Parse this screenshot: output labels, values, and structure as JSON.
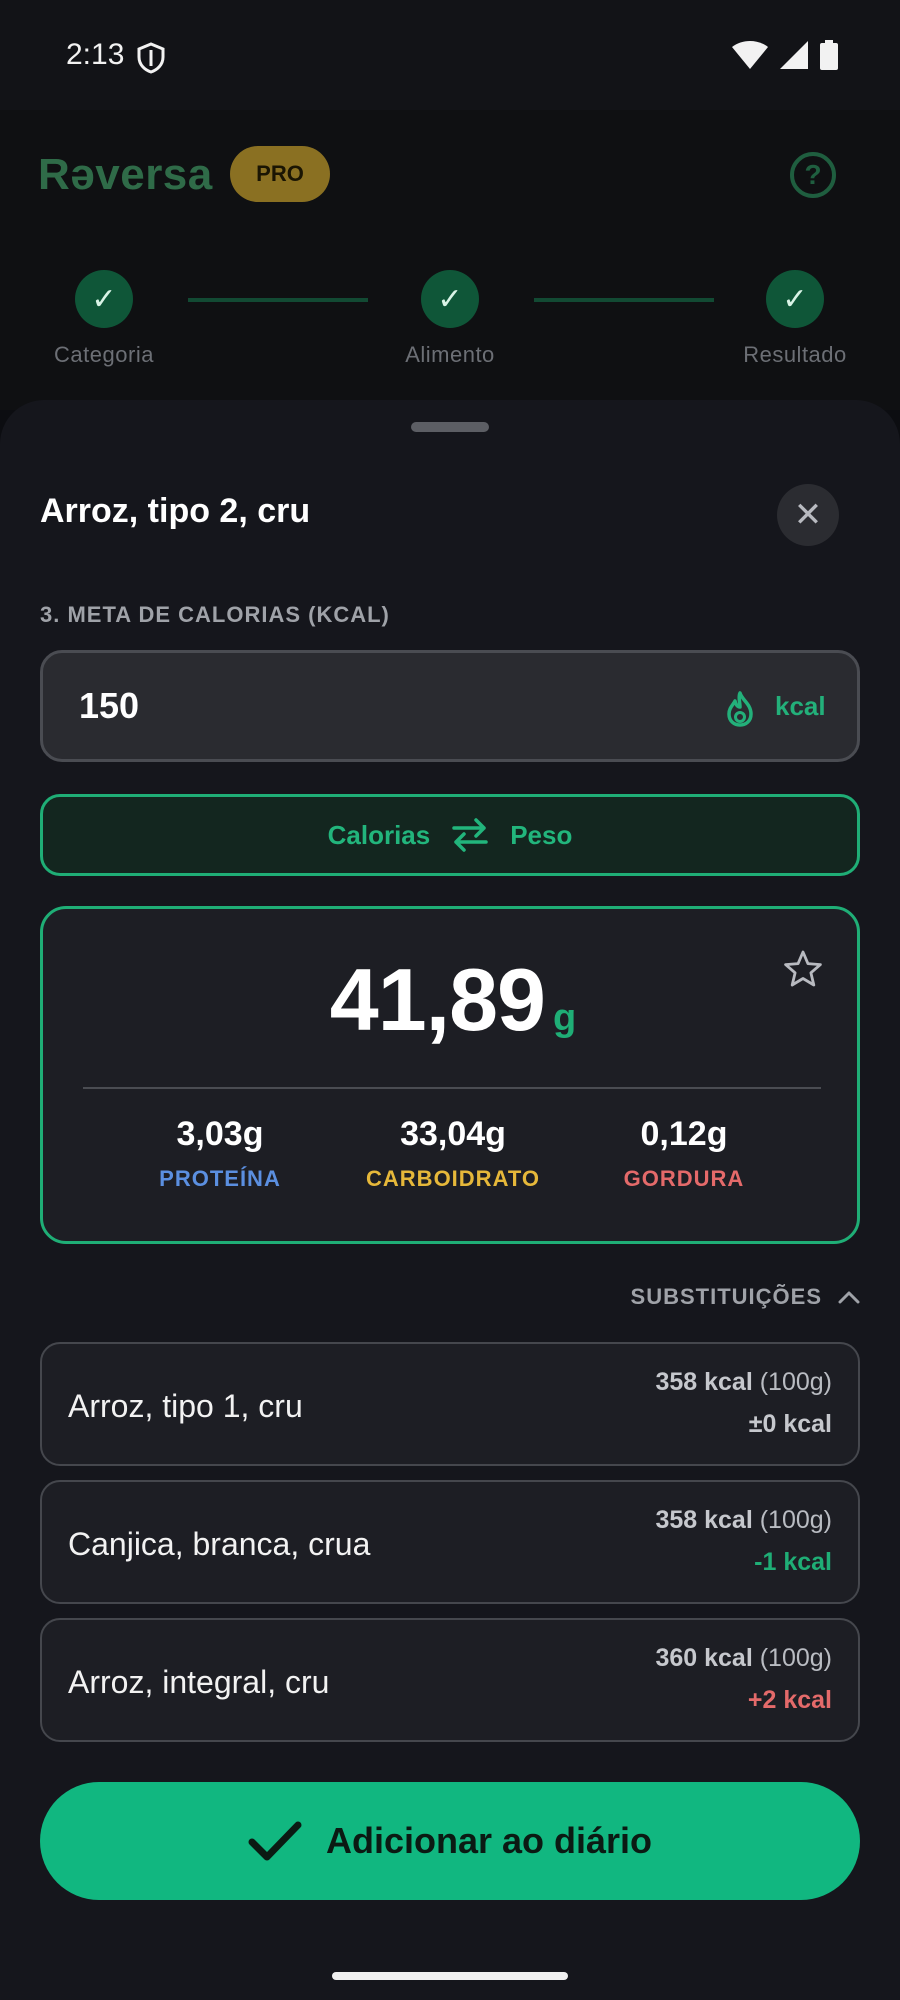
{
  "status_bar": {
    "time": "2:13"
  },
  "header": {
    "logo": "Rəversa",
    "badge": "PRO",
    "help": "?",
    "steps": [
      {
        "label": "Categoria",
        "check": "✓"
      },
      {
        "label": "Alimento",
        "check": "✓"
      },
      {
        "label": "Resultado",
        "check": "✓"
      }
    ]
  },
  "sheet": {
    "title": "Arroz, tipo 2, cru",
    "close": "✕",
    "section_label": "3. META DE CALORIAS (KCAL)",
    "input": {
      "value": "150",
      "unit": "kcal",
      "icon": "flame-icon"
    },
    "toggle": {
      "left": "Calorias",
      "right": "Peso",
      "icon": "swap-icon"
    },
    "result": {
      "value": "41,89",
      "unit": "g",
      "macros": [
        {
          "value": "3,03g",
          "label": "PROTEÍNA",
          "color": "#5b8fe0"
        },
        {
          "value": "33,04g",
          "label": "CARBOIDRATO",
          "color": "#e6b83a"
        },
        {
          "value": "0,12g",
          "label": "GORDURA",
          "color": "#e46a6a"
        }
      ]
    },
    "substitutions": {
      "header": "SUBSTITUIÇÕES",
      "items": [
        {
          "name": "Arroz, tipo 1, cru",
          "kcal": "358 kcal",
          "per": "(100g)",
          "diff": "±0 kcal",
          "diff_color": "#c6c8cd"
        },
        {
          "name": "Canjica, branca, crua",
          "kcal": "358 kcal",
          "per": "(100g)",
          "diff": "-1 kcal",
          "diff_color": "#1fae76"
        },
        {
          "name": "Arroz, integral, cru",
          "kcal": "360 kcal",
          "per": "(100g)",
          "diff": "+2 kcal",
          "diff_color": "#e46a6a"
        }
      ]
    },
    "add_button": "Adicionar ao diário"
  },
  "colors": {
    "accent": "#11b780",
    "background": "#15161c"
  }
}
